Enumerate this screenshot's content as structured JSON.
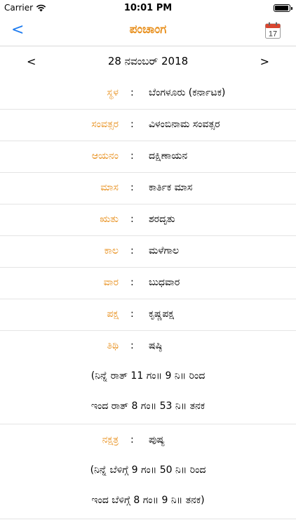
{
  "status_bar": {
    "carrier": "Carrier",
    "time": "10:01 PM",
    "battery_level": 0.95
  },
  "nav": {
    "back_label": "<",
    "title": "ಪಂಚಾಂಗ",
    "calendar_day": "17"
  },
  "date_nav": {
    "prev_label": "<",
    "date": "28 ನವಂಬರ್ 2018",
    "next_label": ">"
  },
  "colon": ":",
  "rows": [
    {
      "label": "ಸ್ಥಳ",
      "value": "ಬೆಂಗಳೂರು (ಕರ್ನಾಟಕ)"
    },
    {
      "label": "ಸಂವತ್ಸರ",
      "value": "ವಿಳಂಬಿನಾಮ ಸಂವತ್ಸರ"
    },
    {
      "label": "ಆಯನಂ",
      "value": "ದಕ್ಷಿಣಾಯನ"
    },
    {
      "label": "ಮಾಸ",
      "value": "ಕಾರ್ತಿಕ ಮಾಸ"
    },
    {
      "label": "ಋತು",
      "value": "ಶರದೃತು"
    },
    {
      "label": "ಕಾಲ",
      "value": "ಮಳೆಗಾಲ"
    },
    {
      "label": "ವಾರ",
      "value": "ಬುಧವಾರ"
    },
    {
      "label": "ಪಕ್ಷ",
      "value": "ಕೃಷ್ಣಪಕ್ಷ"
    }
  ],
  "tithi": {
    "label": "ತಿಥಿ",
    "value": "ಷಷ್ಠಿ",
    "from": "(ನಿನ್ನೆ ರಾತ್ 11 ಗಂ॥ 9 ನಿ॥ ರಿಂದ",
    "to": "ಇಂದ ರಾತ್ 8 ಗಂ॥ 53 ನಿ॥ ತನಕ"
  },
  "nakshatra": {
    "label": "ನಕ್ಷತ್ರ",
    "value": "ಪುಷ್ಯ",
    "from": "(ನಿನ್ನೆ ಬೆಳಿಗ್ಗೆ 9 ಗಂ॥ 50 ನಿ॥ ರಿಂದ",
    "to": "ಇಂದ ಬೆಳಿಗ್ಗೆ 8 ಗಂ॥ 9 ನಿ॥ ತನಕ)"
  }
}
